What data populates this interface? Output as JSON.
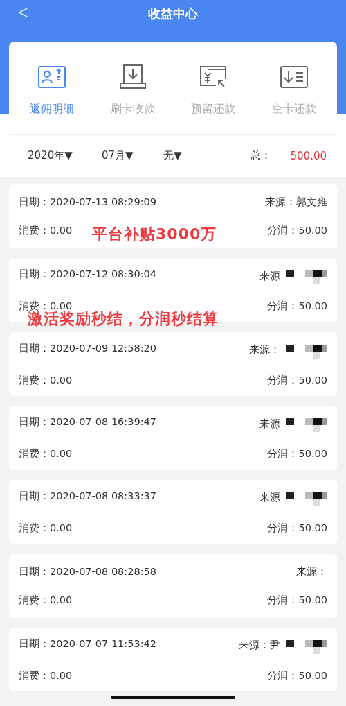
{
  "header": {
    "back": "<",
    "title": "收益中心"
  },
  "tabs": [
    {
      "label": "返佣明细",
      "kind": "rebate",
      "selected": true
    },
    {
      "label": "刷卡收款",
      "kind": "swipe",
      "selected": false
    },
    {
      "label": "预留还款",
      "kind": "reserve",
      "selected": false
    },
    {
      "label": "空卡还款",
      "kind": "empty",
      "selected": false
    }
  ],
  "filters": [
    "2020年▼",
    "07月▼",
    "无▼"
  ],
  "total": {
    "label": "总：",
    "value": "500.00"
  },
  "records": [
    {
      "date": "日期：2020-07-13 08:29:09",
      "source": "来源：郭文雍",
      "redacted": false,
      "spend": "消费：0.00",
      "share": "分润：50.00"
    },
    {
      "date": "日期：2020-07-12 08:30:04",
      "source": "来源",
      "redacted": true,
      "spend": "消费：0.00",
      "share": "分润：50.00"
    },
    {
      "date": "日期：2020-07-09 12:58:20",
      "source": "来源：",
      "redacted": true,
      "spend": "消费：0.00",
      "share": "分润：50.00"
    },
    {
      "date": "日期：2020-07-08 16:39:47",
      "source": "来源",
      "redacted": true,
      "spend": "消费：0.00",
      "share": "分润：50.00"
    },
    {
      "date": "日期：2020-07-08 08:33:37",
      "source": "来源",
      "redacted": true,
      "spend": "消费：0.00",
      "share": "分润：50.00"
    },
    {
      "date": "日期：2020-07-08 08:28:58",
      "source": "来源：",
      "redacted": false,
      "spend": "消费：0.00",
      "share": "分润：50.00"
    },
    {
      "date": "日期：2020-07-07 11:53:42",
      "source": "来源：尹",
      "redacted": true,
      "spend": "消费：0.00",
      "share": "分润：50.00"
    }
  ],
  "overlays": [
    "平台补贴3000万",
    "激活奖励秒结，分润秒结算"
  ]
}
